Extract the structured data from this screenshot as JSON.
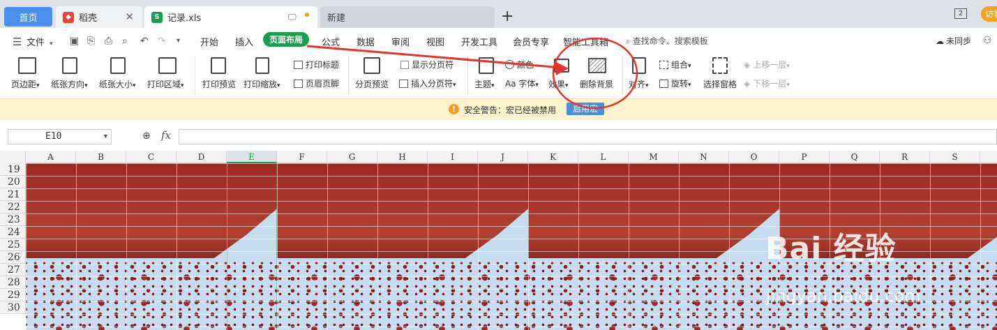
{
  "tabs": {
    "home": "首页",
    "doc1": "稻壳",
    "doc2": "记录.xls",
    "new_tab": "新建",
    "window_count": "2",
    "visitor": "访客"
  },
  "menu": {
    "file": "文件",
    "items": [
      "开始",
      "插入",
      "页面布局",
      "公式",
      "数据",
      "审阅",
      "视图",
      "开发工具",
      "会员专享",
      "智能工具箱"
    ],
    "search": "查找命令、搜索模板",
    "sync": "未同步"
  },
  "ribbon": {
    "margins": "页边距",
    "orientation": "纸张方向",
    "size": "纸张大小",
    "print_area": "打印区域",
    "print_preview": "打印预览",
    "print_scale": "打印缩放",
    "print_titles": "打印标题",
    "header_footer": "页眉页脚",
    "page_break_preview": "分页预览",
    "show_page_break": "显示分页符",
    "insert_page_break": "插入分页符",
    "theme": "主题",
    "colors": "颜色",
    "font": "字体",
    "font_prefix": "Aa",
    "effects": "效果",
    "delete_background": "删除背景",
    "align": "对齐",
    "group": "组合",
    "rotate": "旋转",
    "selection_pane": "选择窗格",
    "bring_forward": "上移一层",
    "send_backward": "下移一层"
  },
  "warning": {
    "text": "安全警告：宏已经被禁用",
    "button": "启用宏"
  },
  "formula": {
    "cell_ref": "E10",
    "fx": "fx"
  },
  "sheet": {
    "columns": [
      "A",
      "B",
      "C",
      "D",
      "E",
      "F",
      "G",
      "H",
      "I",
      "J",
      "K",
      "L",
      "M",
      "N",
      "O",
      "P",
      "Q",
      "R",
      "S"
    ],
    "selected_column": "E",
    "rows": [
      "19",
      "20",
      "21",
      "22",
      "23",
      "24",
      "25",
      "26",
      "27",
      "28",
      "29",
      "30"
    ]
  },
  "watermark": {
    "brand": "Bai 经验",
    "url": "jingyan.baidu.com"
  },
  "colors": {
    "accent": "#1b9e4b",
    "home_tab": "#4b8ff0",
    "annotation": "#e8332a"
  }
}
